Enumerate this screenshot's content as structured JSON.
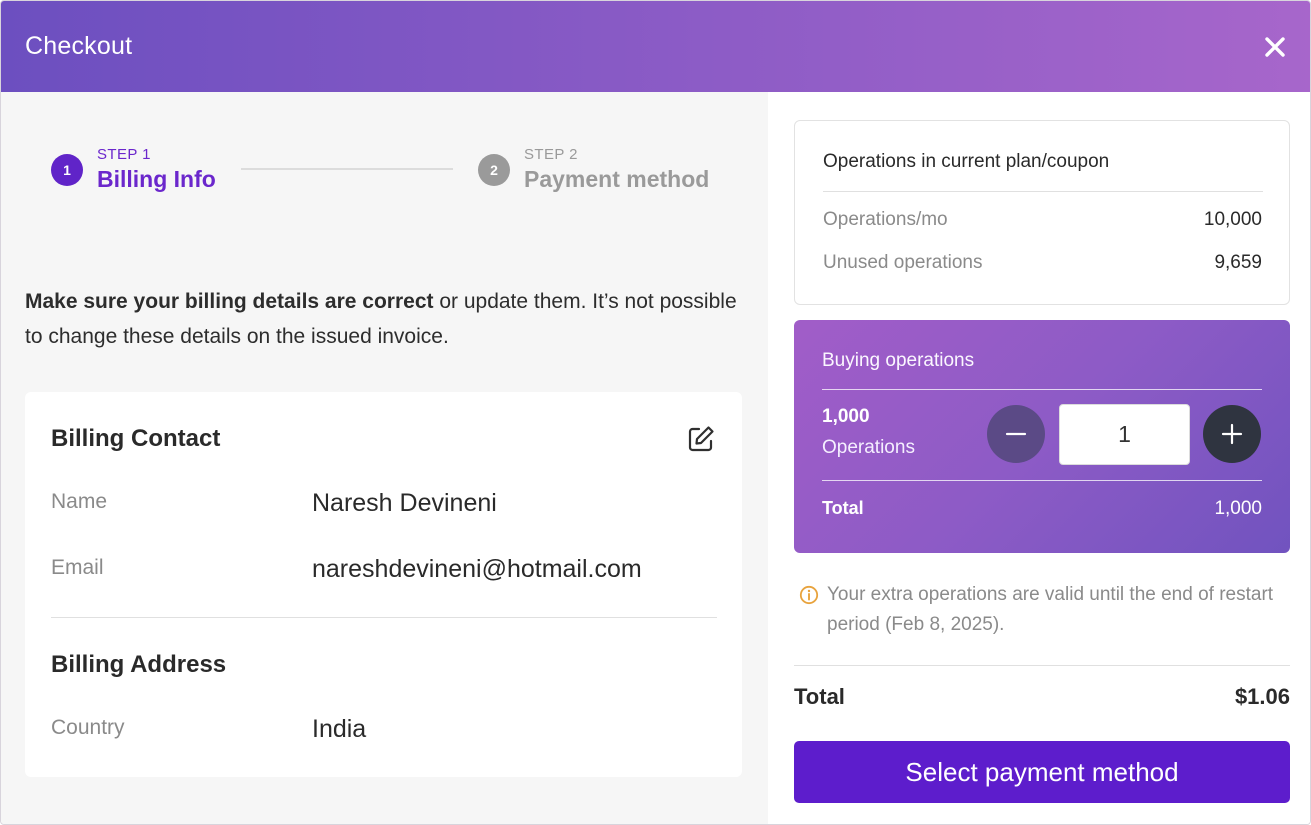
{
  "header": {
    "title": "Checkout"
  },
  "stepper": {
    "steps": [
      {
        "number": "1",
        "caption": "STEP 1",
        "label": "Billing Info",
        "active": true
      },
      {
        "number": "2",
        "caption": "STEP 2",
        "label": "Payment method",
        "active": false
      }
    ]
  },
  "intro": {
    "bold": "Make sure your billing details are correct",
    "rest": " or update them. It’s not possible to change these details on the issued invoice."
  },
  "billing_contact": {
    "title": "Billing Contact",
    "name_label": "Name",
    "name_value": "Naresh Devineni",
    "email_label": "Email",
    "email_value": "nareshdevineni@hotmail.com"
  },
  "billing_address": {
    "title": "Billing Address",
    "country_label": "Country",
    "country_value": "India"
  },
  "plan": {
    "title": "Operations in current plan/coupon",
    "rows": [
      {
        "label": "Operations/mo",
        "value": "10,000"
      },
      {
        "label": "Unused operations",
        "value": "9,659"
      }
    ]
  },
  "buying": {
    "title": "Buying operations",
    "quantity": "1,000",
    "unit": "Operations",
    "input_value": "1",
    "total_label": "Total",
    "total_value": "1,000"
  },
  "note": "Your extra operations are valid until the end of restart period (Feb 8, 2025).",
  "summary": {
    "label": "Total",
    "value": "$1.06"
  },
  "cta": {
    "label": "Select payment method"
  },
  "colors": {
    "accent": "#5d1dcc",
    "step_active": "#6b27cc",
    "header_gradient_start": "#6c4fc0",
    "header_gradient_end": "#a766cb",
    "info_icon": "#e8a33d"
  },
  "icons": {
    "close": "close-icon",
    "edit": "edit-icon",
    "minus": "minus-icon",
    "plus": "plus-icon",
    "info": "info-icon"
  }
}
